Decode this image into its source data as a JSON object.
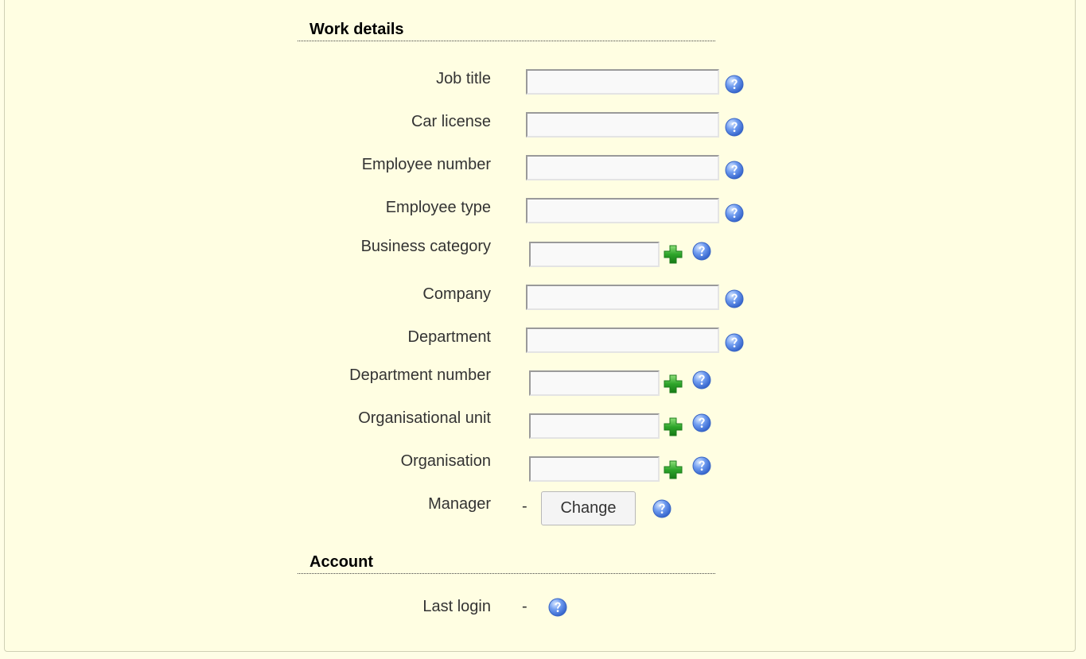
{
  "sections": {
    "work_details": "Work details",
    "account": "Account"
  },
  "fields": {
    "job_title": {
      "label": "Job title",
      "value": ""
    },
    "car_license": {
      "label": "Car license",
      "value": ""
    },
    "employee_number": {
      "label": "Employee number",
      "value": ""
    },
    "employee_type": {
      "label": "Employee type",
      "value": ""
    },
    "business_category": {
      "label": "Business category",
      "value": ""
    },
    "company": {
      "label": "Company",
      "value": ""
    },
    "department": {
      "label": "Department",
      "value": ""
    },
    "department_number": {
      "label": "Department number",
      "value": ""
    },
    "organisational_unit": {
      "label": "Organisational unit",
      "value": ""
    },
    "organisation": {
      "label": "Organisation",
      "value": ""
    },
    "manager": {
      "label": "Manager",
      "value": "-",
      "button": "Change"
    },
    "last_login": {
      "label": "Last login",
      "value": "-"
    }
  },
  "icons": {
    "help": "help-question-icon",
    "add": "add-plus-icon"
  },
  "colors": {
    "background": "#fffee2",
    "help_blue": "#4a7fe0",
    "plus_green": "#2ea52a"
  }
}
